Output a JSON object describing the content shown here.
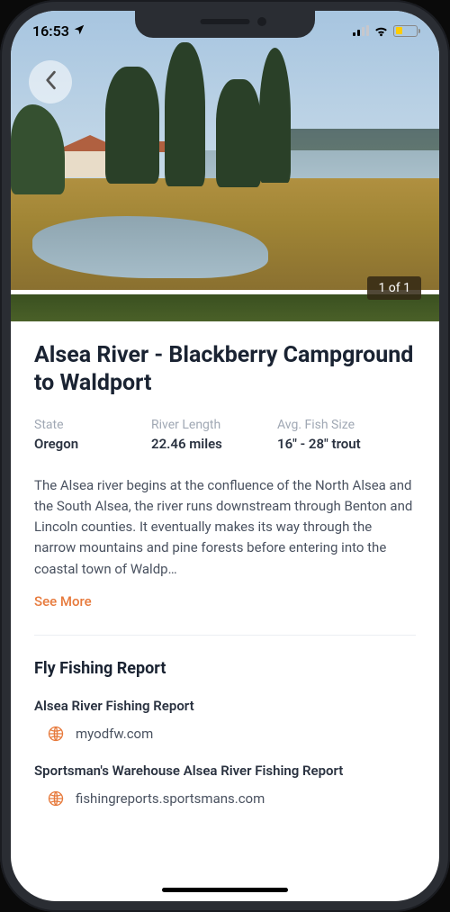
{
  "status": {
    "time": "16:53"
  },
  "hero": {
    "photo_counter": "1 of 1"
  },
  "page": {
    "title": "Alsea River - Blackberry Campground to Waldport"
  },
  "stats": [
    {
      "label": "State",
      "value": "Oregon"
    },
    {
      "label": "River Length",
      "value": "22.46 miles"
    },
    {
      "label": "Avg. Fish Size",
      "value": "16\" - 28\" trout"
    }
  ],
  "description": "The Alsea river begins at the confluence of the North Alsea and the South Alsea, the river runs downstream through Benton and Lincoln counties. It eventually makes its way through the narrow mountains and pine forests before entering into the coastal town of Waldp…",
  "see_more_label": "See More",
  "fly_section": {
    "title": "Fly Fishing Report",
    "reports": [
      {
        "title": "Alsea River Fishing Report",
        "url": "myodfw.com"
      },
      {
        "title": "Sportsman's Warehouse Alsea River Fishing Report",
        "url": "fishingreports.sportsmans.com"
      }
    ]
  },
  "colors": {
    "accent": "#e77a3c"
  }
}
